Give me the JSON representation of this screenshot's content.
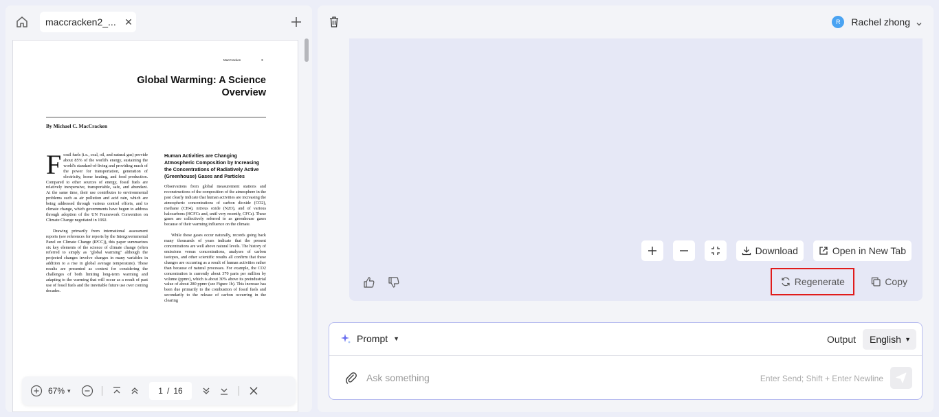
{
  "left_panel": {
    "tab_label": "maccracken2_...",
    "pdf": {
      "running_head": "MacCracken",
      "running_page": "3",
      "title": "Global Warming: A Science Overview",
      "byline": "By Michael C. MacCracken",
      "drop_cap": "F",
      "col1_p1": "ossil fuels (i.e., coal, oil, and natural gas) provide about 85% of the world's energy, sustaining the world's standard-of-living and providing much of the power for transportation, generation of electricity, home heating, and food production. Compared to other sources of energy, fossil fuels are relatively inexpensive, transportable, safe, and abundant. At the same time, their use contributes to environmental problems such as air pollution and acid rain, which are being addressed through various control efforts, and to climate change, which governments have begun to address through adoption of the UN Framework Convention on Climate Change negotiated in 1992.",
      "col1_p2": "Drawing primarily from international assessment reports (see references for reports by the Intergovernmental Panel on Climate Change (IPCC)), this paper summarizes six key elements of the science of climate change (often referred to simply as \"global warming\" although the projected changes involve changes in many variables in addition to a rise in global average temperature). These results are presented as context for considering the challenges of both limiting long-term warming and adapting to the warming that will occur as a result of past use of fossil fuels and the inevitable future use over coming decades.",
      "section_head": "Human Activities are Changing Atmospheric Composition by Increasing the Concentrations of Radiatively Active (Greenhouse) Gases and Particles",
      "col2_p1": "Observations from global measurement stations and reconstructions of the composition of the atmosphere in the past clearly indicate that human activities are increasing the atmospheric concentrations of carbon dioxide (CO2), methane (CH4), nitrous oxide (N2O), and of various halocarbons (HCFCs and, until very recently, CFCs). These gases are collectively referred to as greenhouse gases because of their warming influence on the climate.",
      "col2_p2": "While these gases occur naturally, records going back many thousands of years indicate that the present concentrations are well above natural levels. The history of emissions versus concentrations, analyses of carbon isotopes, and other scientific results all confirm that these changes are occurring as a result of human activities rather than because of natural processes. For example, the CO2 concentration is currently about 370 parts per million by volume (ppmv), which is about 30% above its preindustrial value of about 280 ppmv (see Figure 1b). This increase has been due primarily to the combustion of fossil fuels and secondarily to the release of carbon occurring in the clearing"
    },
    "toolbar": {
      "zoom": "67%",
      "page_current": "1",
      "page_sep": "/",
      "page_total": "16"
    }
  },
  "right_panel": {
    "user": {
      "initial": "R",
      "name": "Rachel zhong"
    },
    "image_tools": {
      "download": "Download",
      "open_new_tab": "Open in New Tab"
    },
    "actions": {
      "regenerate": "Regenerate",
      "copy": "Copy"
    },
    "composer": {
      "prompt_label": "Prompt",
      "output_label": "Output",
      "language": "English",
      "placeholder": "Ask something",
      "hint": "Enter Send; Shift + Enter Newline"
    },
    "highlight_color": "#e01b1b",
    "accent_color": "#6a6ff0"
  }
}
